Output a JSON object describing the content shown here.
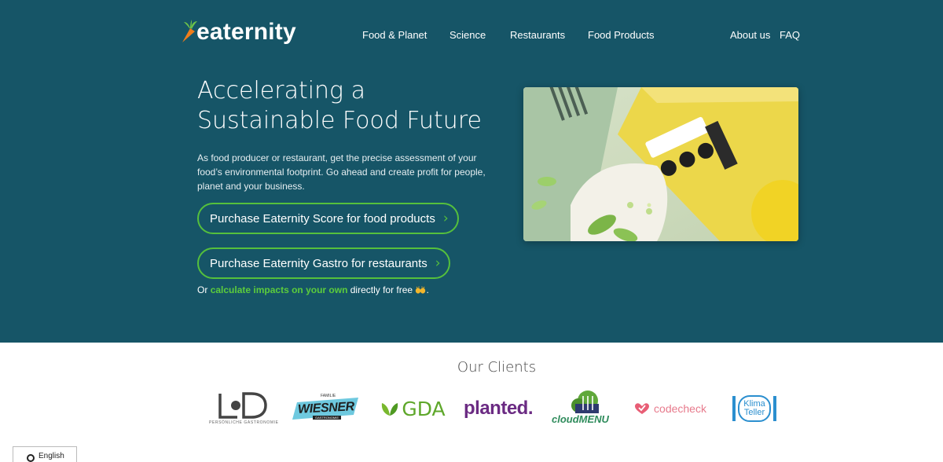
{
  "header": {
    "logo_text": "eaternity",
    "nav": [
      {
        "label": "Food & Planet"
      },
      {
        "label": "Science"
      },
      {
        "label": "Restaurants"
      },
      {
        "label": "Food Products"
      }
    ],
    "nav_right": [
      {
        "label": "About us"
      },
      {
        "label": "FAQ"
      }
    ]
  },
  "hero": {
    "title": "Accelerating a Sustainable Food Future",
    "intro": "As food producer or restaurant, get the precise assessment of your food’s environmental footprint. Go ahead and create profit for people, planet and your business.",
    "cta_products": "Purchase Eaternity Score for food products",
    "cta_gastro": "Purchase Eaternity Gastro for restaurants",
    "free_prefix": "Or",
    "free_link": "calculate impacts on your own",
    "free_suffix": "directly for free",
    "free_end": "."
  },
  "clients": {
    "title": "Our Clients",
    "logos": [
      {
        "name": "LD",
        "caption": "PERSÖNLICHE GASTRONOMIE"
      },
      {
        "name": "WIESNER",
        "small_top": "FAMILIE",
        "small_bottom": "GASTRONOMIE"
      },
      {
        "name": "GDA"
      },
      {
        "name": "planted."
      },
      {
        "name": "cloudMENU"
      },
      {
        "name": "codecheck"
      },
      {
        "name": "Klima Teller"
      }
    ]
  },
  "language": {
    "selected": "English"
  },
  "colors": {
    "hero_bg": "#165567",
    "accent_green": "#55c03c",
    "logo_orange": "#ef7d1a"
  }
}
